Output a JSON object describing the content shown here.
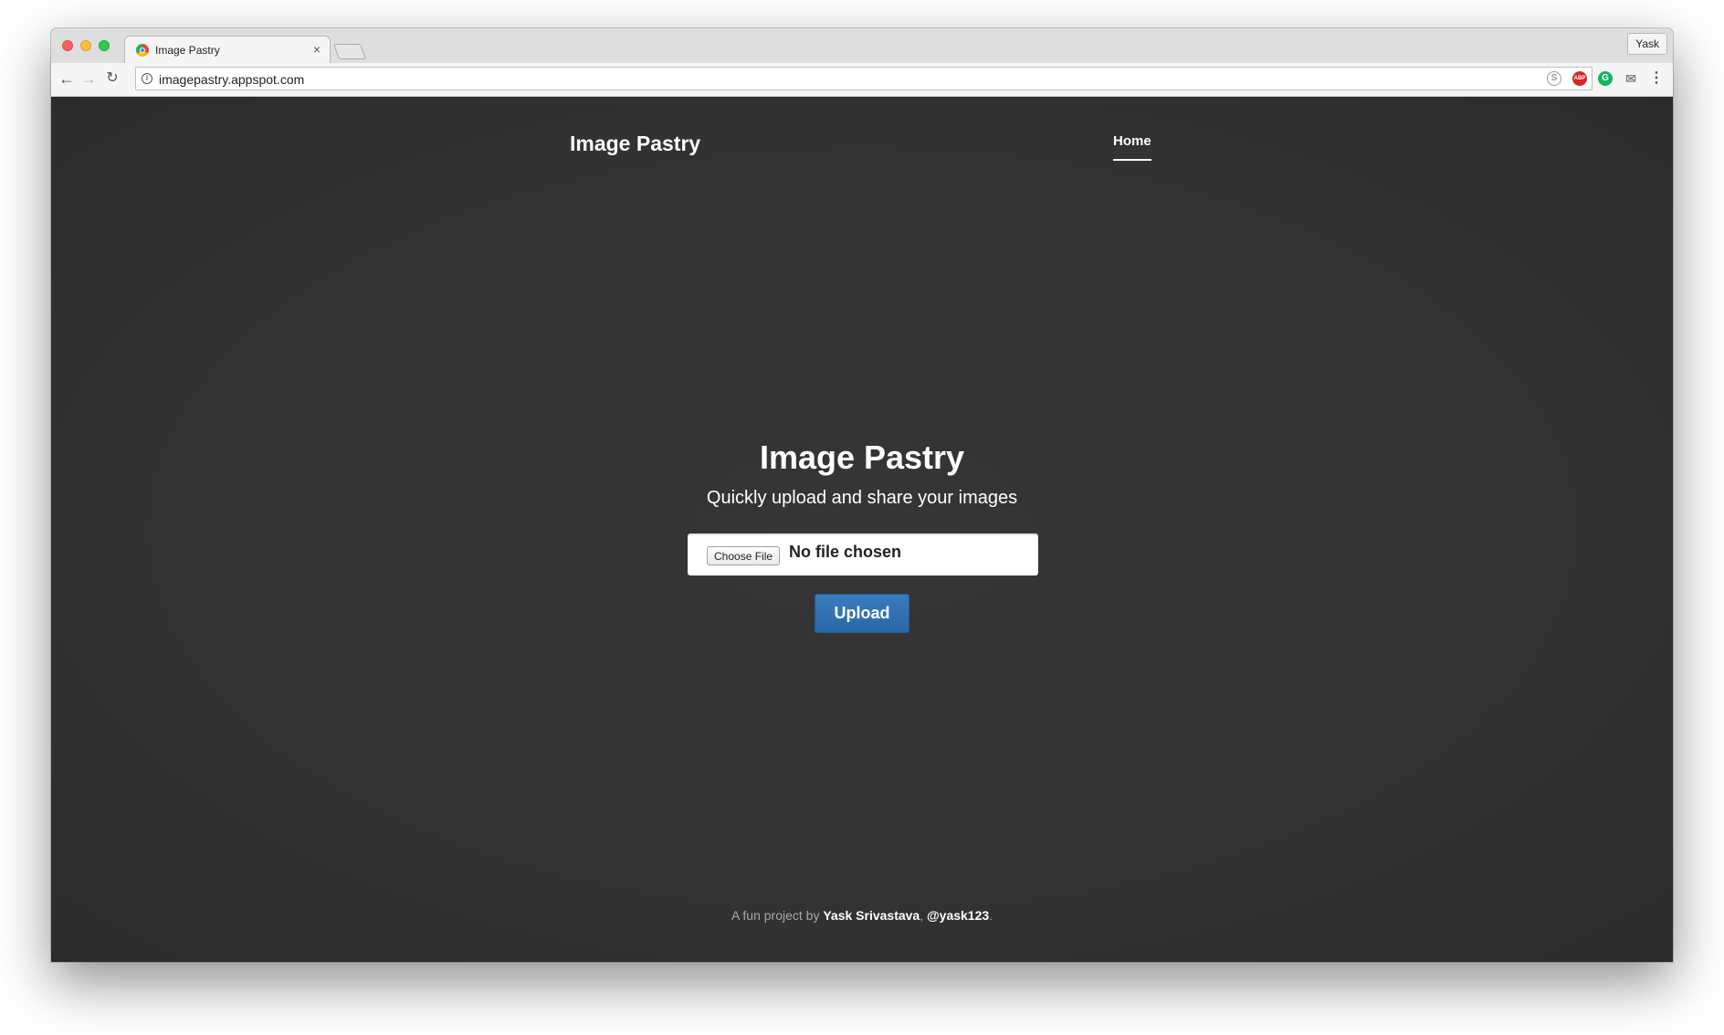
{
  "browser": {
    "tab_title": "Image Pastry",
    "tab_close": "×",
    "profile_name": "Yask",
    "url": "imagepastry.appspot.com",
    "extensions": {
      "abp_label": "ABP",
      "grammarly_label": "G"
    }
  },
  "site": {
    "brand": "Image Pastry",
    "nav": [
      {
        "label": "Home",
        "active": true
      }
    ]
  },
  "hero": {
    "title": "Image Pastry",
    "subtitle": "Quickly upload and share your images"
  },
  "upload_form": {
    "choose_button_label": "Choose File",
    "file_status": "No file chosen",
    "upload_button_label": "Upload"
  },
  "footer": {
    "prefix": "A fun project by ",
    "author": "Yask Srivastava",
    "separator": ", ",
    "handle": "@yask123",
    "suffix": "."
  },
  "colors": {
    "page_background": "#333333",
    "upload_button": "#2f70b0"
  }
}
